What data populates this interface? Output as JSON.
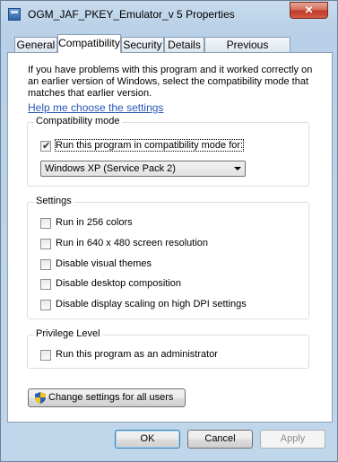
{
  "window": {
    "title": "OGM_JAF_PKEY_Emulator_v 5 Properties",
    "close_label": "✕"
  },
  "tabs": [
    {
      "label": "General"
    },
    {
      "label": "Compatibility"
    },
    {
      "label": "Security"
    },
    {
      "label": "Details"
    },
    {
      "label": "Previous Versions"
    }
  ],
  "active_tab": "Compatibility",
  "intro_text": "If you have problems with this program and it worked correctly on an earlier version of Windows, select the compatibility mode that matches that earlier version.",
  "help_link": "Help me choose the settings",
  "compat_group": {
    "label": "Compatibility mode",
    "checkbox_label": "Run this program in compatibility mode for:",
    "checked": true,
    "selected_mode": "Windows XP (Service Pack 2)"
  },
  "settings_group": {
    "label": "Settings",
    "items": [
      {
        "label": "Run in 256 colors",
        "checked": false
      },
      {
        "label": "Run in 640 x 480 screen resolution",
        "checked": false
      },
      {
        "label": "Disable visual themes",
        "checked": false
      },
      {
        "label": "Disable desktop composition",
        "checked": false
      },
      {
        "label": "Disable display scaling on high DPI settings",
        "checked": false
      }
    ]
  },
  "privilege_group": {
    "label": "Privilege Level",
    "checkbox_label": "Run this program as an administrator",
    "checked": false
  },
  "change_settings_button": "Change settings for all users",
  "buttons": {
    "ok": "OK",
    "cancel": "Cancel",
    "apply": "Apply"
  }
}
